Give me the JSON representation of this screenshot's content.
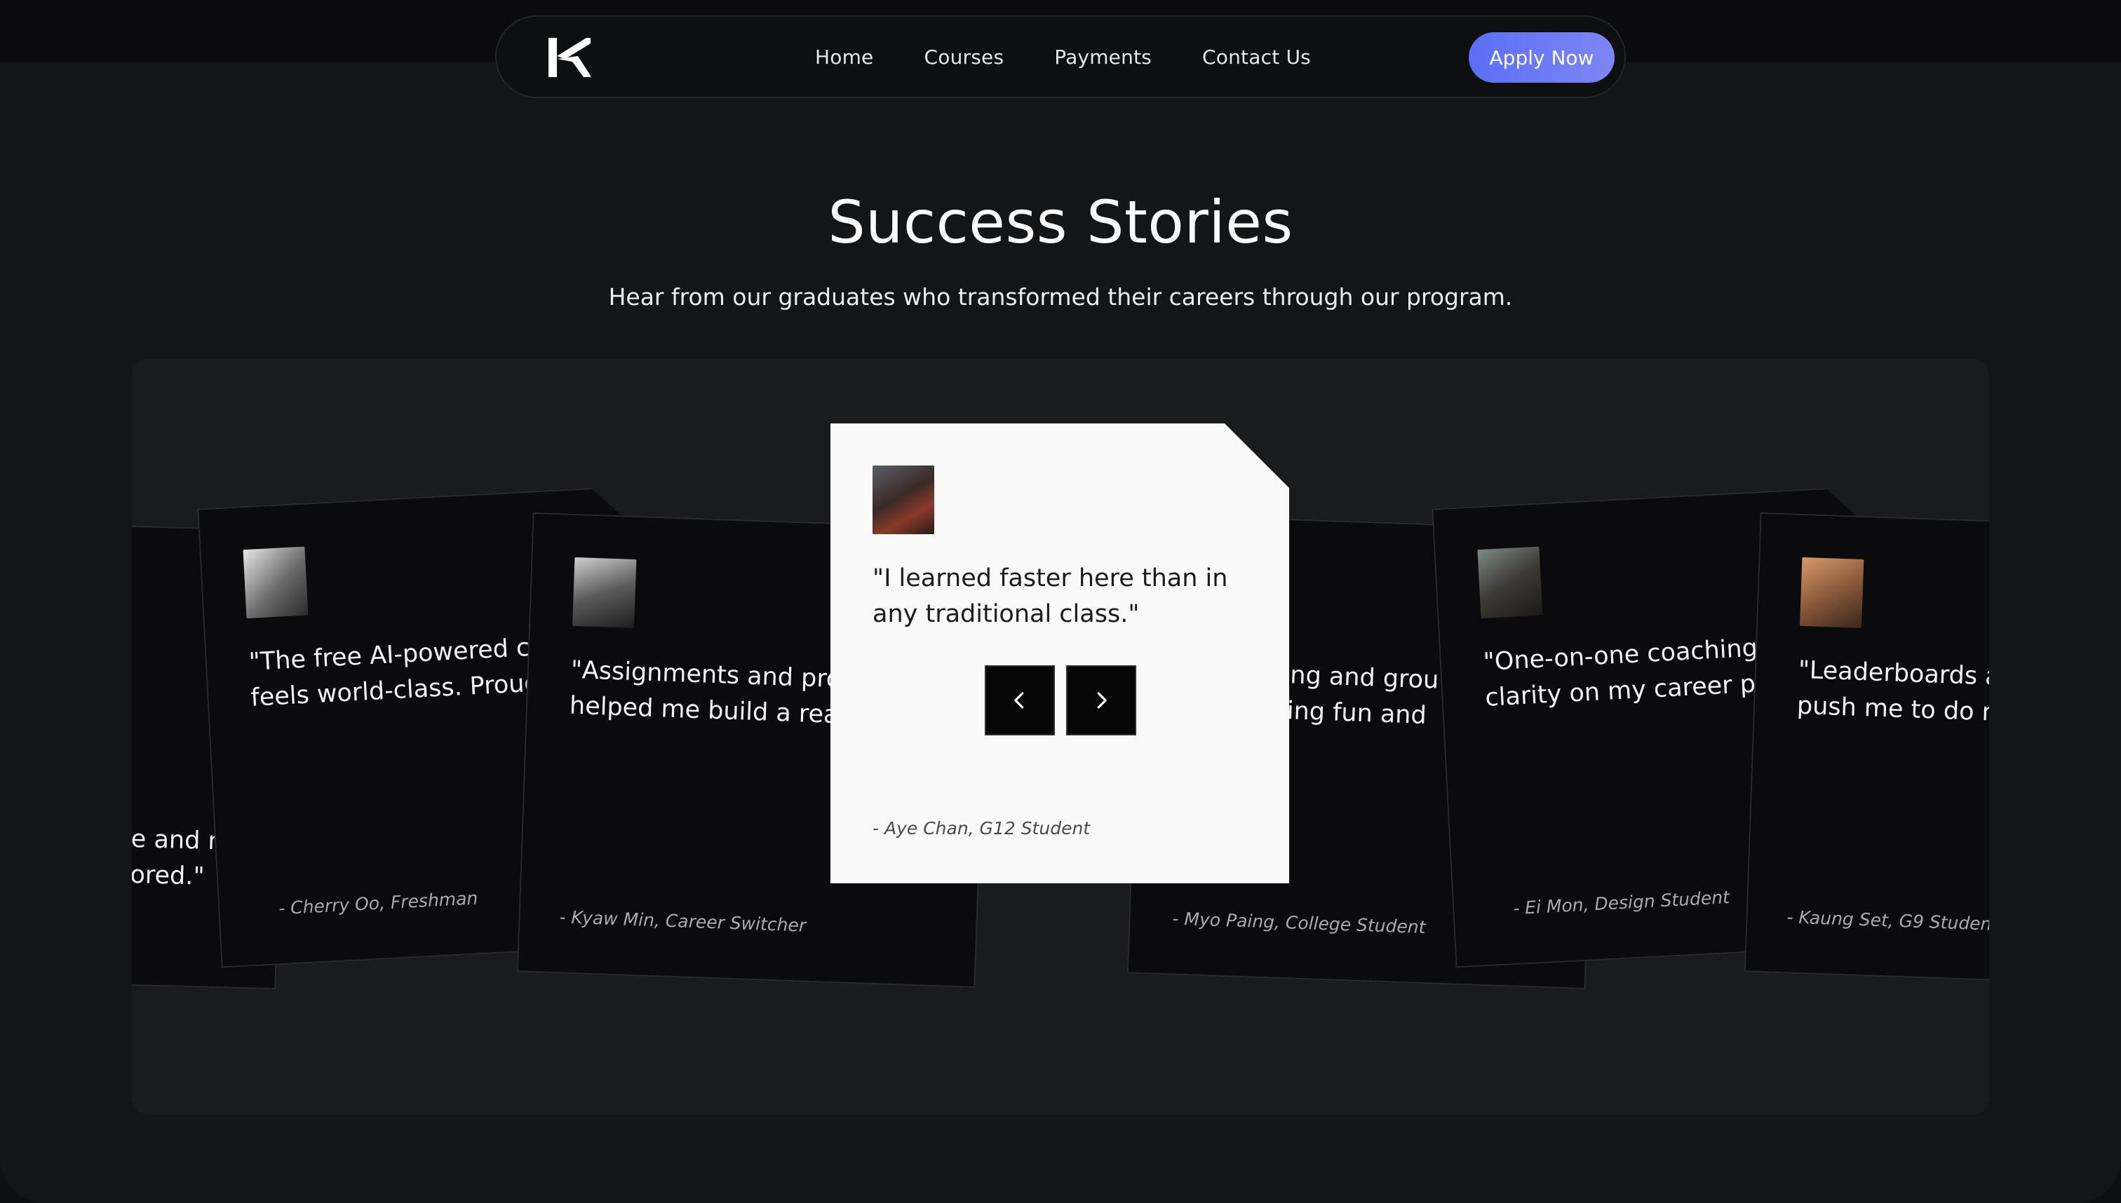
{
  "nav": {
    "logo": "K-logo-icon",
    "links": [
      "Home",
      "Courses",
      "Payments",
      "Contact Us"
    ],
    "cta": "Apply Now"
  },
  "hero": {
    "title": "Success Stories",
    "subtitle": "Hear from our graduates who transformed their careers through our program."
  },
  "testimonials": [
    {
      "quote_visible": "e and m\nored.\"",
      "author": ""
    },
    {
      "quote": "\"The free AI-powered ca\nfeels world-class. Proud",
      "author": "- Cherry Oo, Freshman"
    },
    {
      "quote": "\"Assignments and proje\nhelped me build a real",
      "author": "- Kyaw Min, Career Switcher"
    },
    {
      "quote": "\"I learned faster here than in any traditional class.\"",
      "author": "- Aye Chan, G12 Student"
    },
    {
      "quote": "rning and grou\ndying fun and",
      "author": "- Myo Paing, College Student"
    },
    {
      "quote": "\"One-on-one coaching g\nclarity on my career pat",
      "author": "- Ei Mon, Design Student"
    },
    {
      "quote": "\"Leaderboards ar\npush me to do m",
      "author": "- Kaung Set, G9 Student"
    }
  ],
  "carousel": {
    "prev_icon": "chevron-left-icon",
    "next_icon": "chevron-right-icon"
  },
  "colors": {
    "accent_start": "#5a6ff6",
    "accent_end": "#7f86f5",
    "background": "#141517",
    "active_card": "#fafafa"
  }
}
